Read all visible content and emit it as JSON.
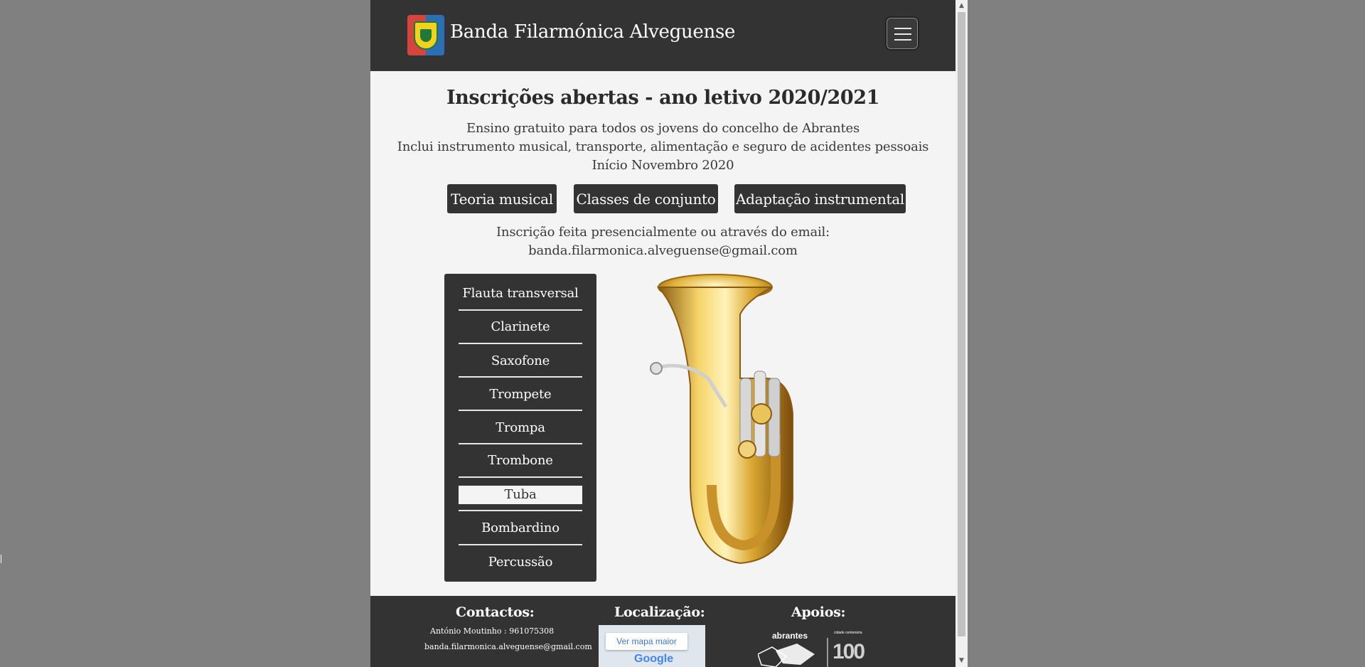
{
  "header": {
    "site_title": "Banda Filarmónica Alveguense"
  },
  "hero": {
    "headline": "Inscrições abertas - ano letivo 2020/2021",
    "lines": [
      "Ensino gratuito para todos os jovens do concelho de Abrantes",
      "Inclui instrumento musical, transporte, alimentação e seguro de acidentes pessoais",
      "Início Novembro 2020"
    ]
  },
  "courses": [
    {
      "label": "Teoria musical"
    },
    {
      "label": "Classes de conjunto"
    },
    {
      "label": "Adaptação instrumental"
    }
  ],
  "enrollment": {
    "line1": "Inscrição feita presencialmente ou através do email:",
    "email": "banda.filarmonica.alveguense@gmail.com"
  },
  "instruments": {
    "selected": "Tuba",
    "items": [
      {
        "label": "Flauta transversal"
      },
      {
        "label": "Clarinete"
      },
      {
        "label": "Saxofone"
      },
      {
        "label": "Trompete"
      },
      {
        "label": "Trompa"
      },
      {
        "label": "Trombone"
      },
      {
        "label": "Tuba"
      },
      {
        "label": "Bombardino"
      },
      {
        "label": "Percussão"
      }
    ]
  },
  "footer": {
    "contacts": {
      "heading": "Contactos:",
      "phone_line": "António Moutinho : 961075308",
      "email": "banda.filarmonica.alveguense@gmail.com"
    },
    "location": {
      "heading": "Localização:",
      "map_button": "Ver mapa maior",
      "map_brand": "Google"
    },
    "sponsors": {
      "heading": "Apoios:",
      "sponsor_name": "abrantes",
      "badge_text": "cidade centenária",
      "badge_number": "100"
    }
  },
  "colors": {
    "dark": "#333333",
    "page_background": "#f4f4f4",
    "outer_background": "#808080"
  },
  "icons": {
    "menu": "hamburger-icon",
    "logo": "band-crest-icon",
    "scroll_up": "triangle-up-icon",
    "scroll_down": "triangle-down-icon"
  }
}
